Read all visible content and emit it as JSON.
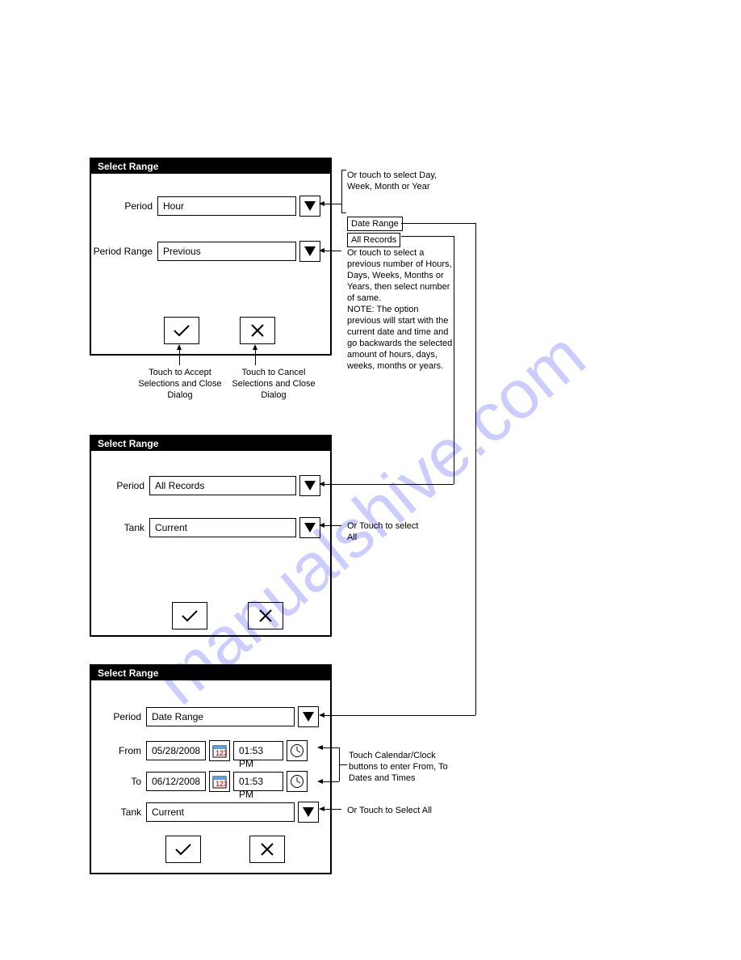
{
  "watermark": "manualshive.com",
  "dialog1": {
    "title": "Select Range",
    "period_label": "Period",
    "period_value": "Hour",
    "range_label": "Period Range",
    "range_value": "Previous"
  },
  "dialog2": {
    "title": "Select Range",
    "period_label": "Period",
    "period_value": "All Records",
    "tank_label": "Tank",
    "tank_value": "Current"
  },
  "dialog3": {
    "title": "Select Range",
    "period_label": "Period",
    "period_value": "Date Range",
    "from_label": "From",
    "from_date": "05/28/2008",
    "from_time": "01:53 PM",
    "to_label": "To",
    "to_date": "06/12/2008",
    "to_time": "01:53 PM",
    "tank_label": "Tank",
    "tank_value": "Current"
  },
  "callouts": {
    "period_opts": "Or touch to select Day, Week, Month or Year",
    "boxed_daterange": "Date Range",
    "boxed_allrecords": "All Records",
    "range_long": "Or touch to select a previous number of Hours, Days, Weeks, Months or Years, then select number of same.\nNOTE: The option previous will start with the current date and time and go backwards the selected amount of hours, days, weeks, months or years.",
    "accept": "Touch to Accept Selections and Close Dialog",
    "cancel": "Touch to Cancel Selections and Close Dialog",
    "tank_all": "Or Touch to select All",
    "cal_clock": "Touch Calendar/Clock buttons to enter From, To Dates and Times",
    "tank_all3": "Or Touch to Select All"
  }
}
